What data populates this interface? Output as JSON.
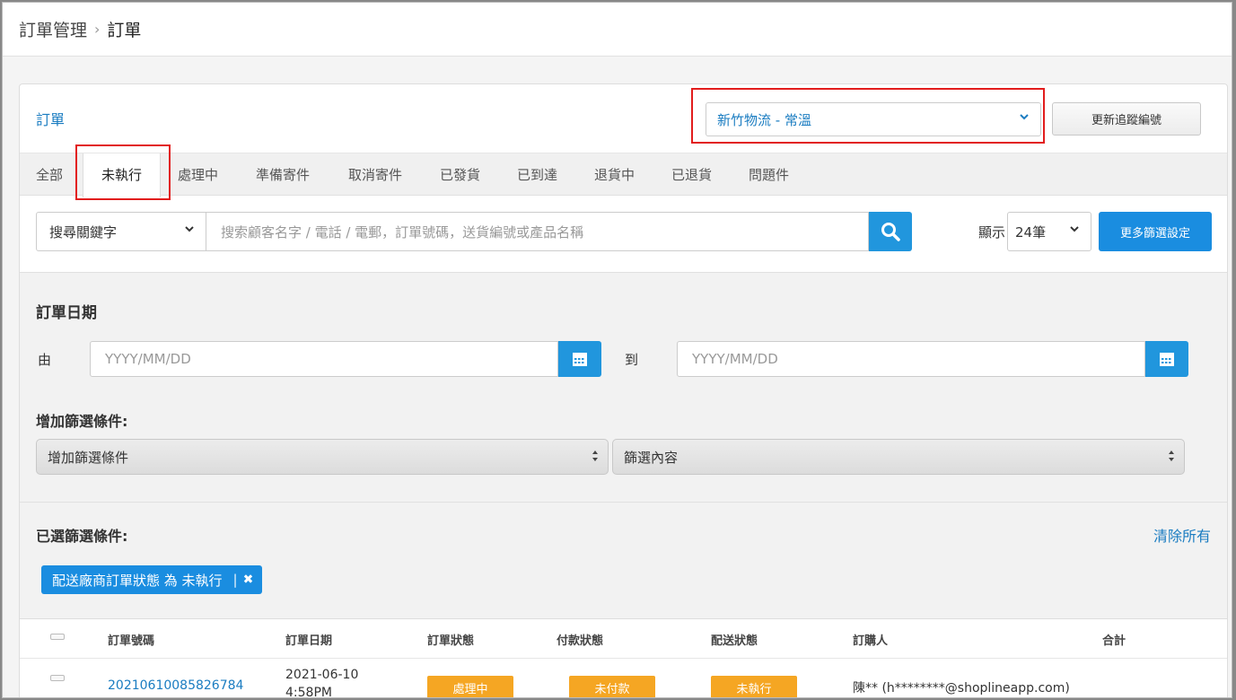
{
  "breadcrumb": {
    "parent": "訂單管理",
    "separator": "›",
    "current": "訂單"
  },
  "card": {
    "title": "訂單"
  },
  "logistics": {
    "selected": "新竹物流 - 常溫",
    "update_button": "更新追蹤編號"
  },
  "tabs": [
    {
      "label": "全部"
    },
    {
      "label": "未執行",
      "active": true
    },
    {
      "label": "處理中"
    },
    {
      "label": "準備寄件"
    },
    {
      "label": "取消寄件"
    },
    {
      "label": "已發貨"
    },
    {
      "label": "已到達"
    },
    {
      "label": "退貨中"
    },
    {
      "label": "已退貨"
    },
    {
      "label": "問題件"
    }
  ],
  "search": {
    "keyword_type": "搜尋關鍵字",
    "placeholder": "搜索顧客名字 / 電話 / 電郵，訂單號碼，送貨編號或產品名稱",
    "show_label": "顯示",
    "per_page": "24筆",
    "more_filters": "更多篩選設定"
  },
  "date_filter": {
    "title": "訂單日期",
    "from_label": "由",
    "to_label": "到",
    "from_placeholder": "YYYY/MM/DD",
    "to_placeholder": "YYYY/MM/DD"
  },
  "add_condition": {
    "title": "增加篩選條件:",
    "condition_select": "增加篩選條件",
    "content_select": "篩選內容"
  },
  "selected_filters": {
    "title": "已選篩選條件:",
    "clear_all": "清除所有",
    "chip": "配送廠商訂單狀態 為 未執行",
    "chip_remove": "✖"
  },
  "table": {
    "headers": {
      "order_no": "訂單號碼",
      "order_date": "訂單日期",
      "order_status": "訂單狀態",
      "payment_status": "付款狀態",
      "delivery_status": "配送狀態",
      "buyer": "訂購人",
      "total": "合計"
    },
    "rows": [
      {
        "order_no": "20210610085826784",
        "date": "2021-06-10",
        "time": "4:58PM",
        "order_status": "處理中",
        "payment_status": "未付款",
        "delivery_status": "未執行",
        "buyer": "陳** (h********@shoplineapp.com)",
        "total": ""
      }
    ]
  },
  "colors": {
    "primary": "#1a8de0",
    "link": "#1a7cc1",
    "badge": "#f5a623",
    "highlight": "#e21d1d"
  }
}
